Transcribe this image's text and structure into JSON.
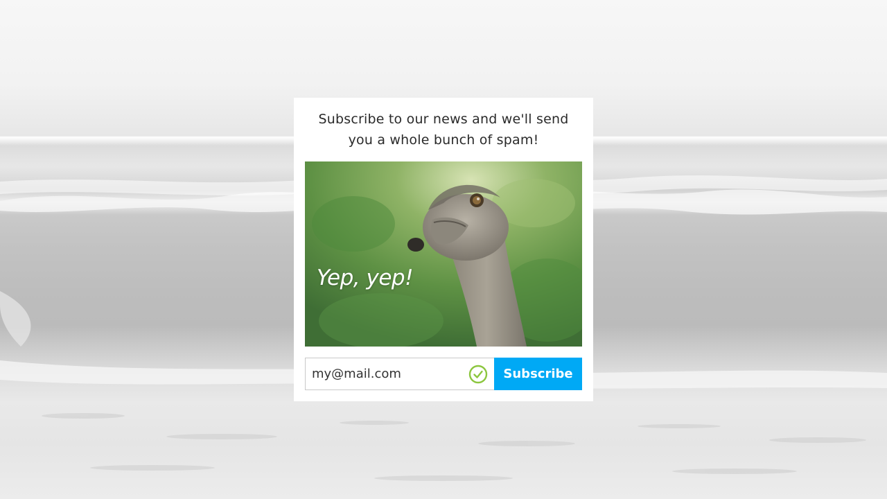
{
  "card": {
    "title": "Subscribe to our news and we'll send you a whole bunch of spam!",
    "image_caption": "Yep, yep!"
  },
  "form": {
    "email_value": "my@mail.com",
    "email_valid_icon": "check-circle-icon",
    "subscribe_label": "Subscribe"
  },
  "colors": {
    "accent": "#00a9f5",
    "valid": "#8cc63f",
    "card_background": "#ffffff"
  }
}
